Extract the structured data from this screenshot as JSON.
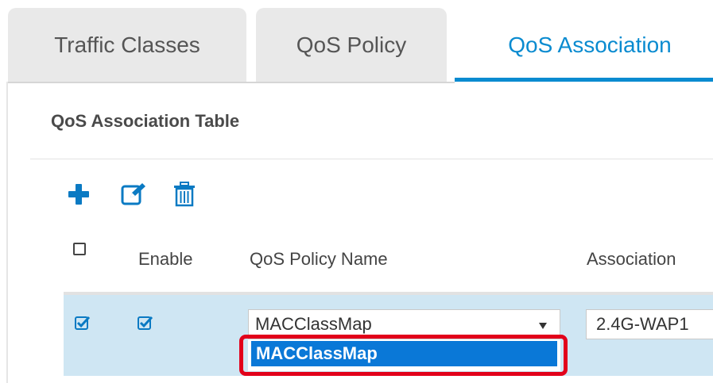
{
  "tabs": [
    {
      "label": "Traffic Classes",
      "active": false
    },
    {
      "label": "QoS Policy",
      "active": false
    },
    {
      "label": "QoS Association",
      "active": true
    }
  ],
  "section": {
    "title": "QoS Association Table"
  },
  "toolbar": {
    "add_icon": "plus-icon",
    "edit_icon": "edit-icon",
    "delete_icon": "trash-icon"
  },
  "table": {
    "columns": [
      "Enable",
      "QoS Policy Name",
      "Association"
    ],
    "header_checkbox_checked": false,
    "rows": [
      {
        "selected": true,
        "enabled": true,
        "policy_name": "MACClassMap",
        "association": "2.4G-WAP1"
      }
    ]
  },
  "dropdown": {
    "options": [
      "MACClassMap"
    ],
    "highlighted_option": "MACClassMap"
  },
  "colors": {
    "accent": "#0a8bd0",
    "selected_row": "#cfe6f3",
    "dropdown_highlight": "#0a78d7",
    "annotation_outline": "#e2001a"
  }
}
